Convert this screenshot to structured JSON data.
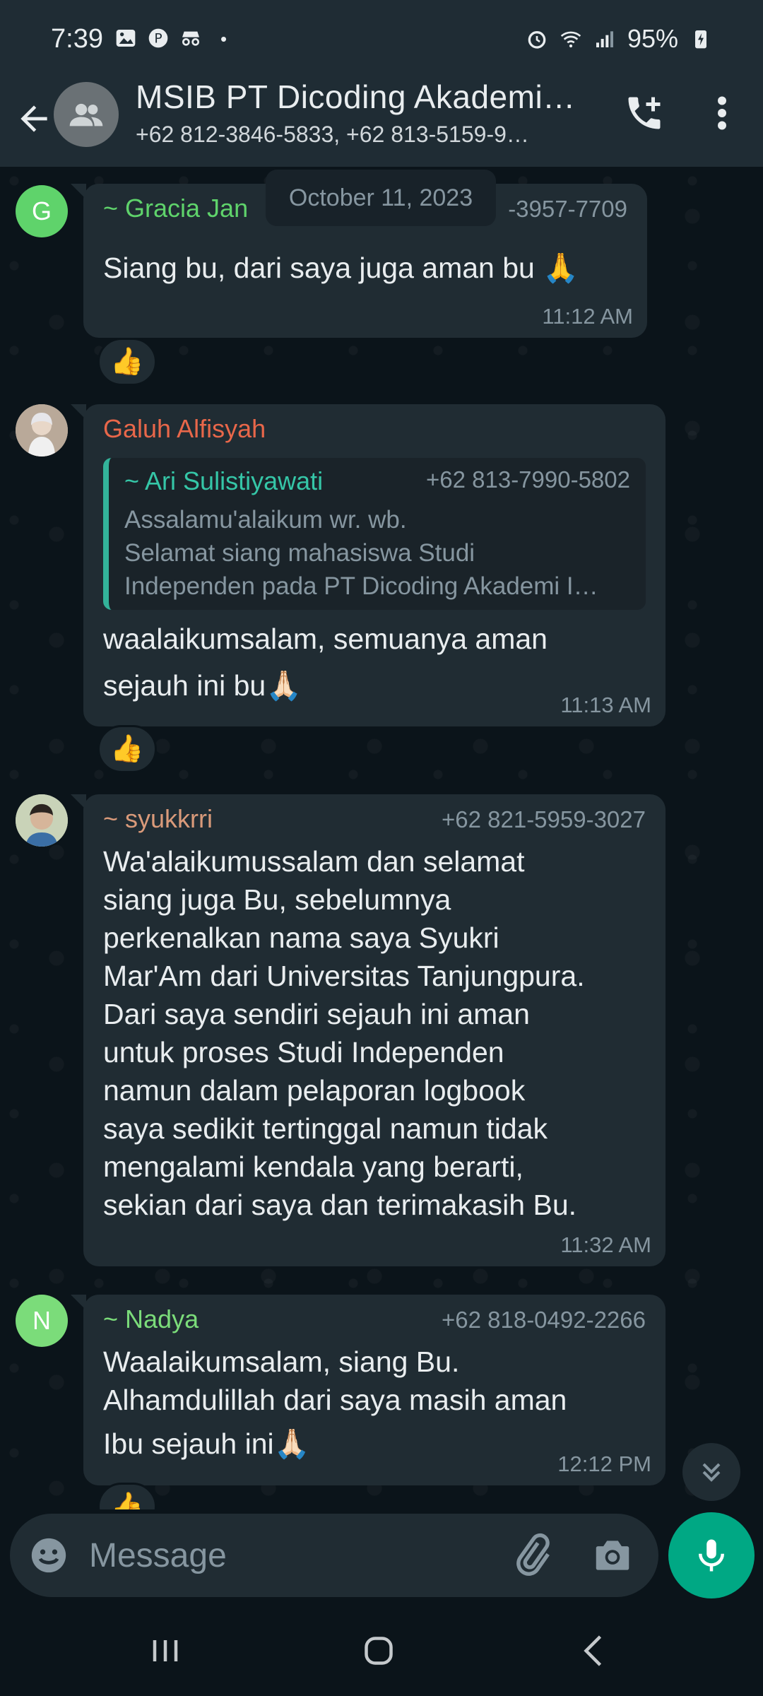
{
  "status_bar": {
    "time": "7:39",
    "dot": "•",
    "battery": "95%"
  },
  "header": {
    "title": "MSIB PT Dicoding Akademi…",
    "subtitle": "+62 812-3846-5833, +62 813-5159-9…"
  },
  "date_chip": "October 11, 2023",
  "messages": [
    {
      "avatar_letter": "G",
      "avatar_color": "#5fd36b",
      "sender": "~ Gracia Jan",
      "sender_color": "#5fd36b",
      "phone": "-3957-7709",
      "text": "Siang bu, dari saya juga aman bu 🙏",
      "time": "11:12 AM",
      "reaction": "👍"
    },
    {
      "sender": "Galuh Alfisyah",
      "sender_color": "#e8674a",
      "quote": {
        "name": "~ Ari Sulistiyawati",
        "phone": "+62 813-7990-5802",
        "lines": [
          "Assalamu'alaikum wr. wb.",
          "Selamat siang mahasiswa Studi",
          "Independen pada PT Dicoding Akademi I…"
        ]
      },
      "text_lines": [
        "waalaikumsalam, semuanya aman",
        "sejauh ini bu🙏🏻"
      ],
      "time": "11:13 AM",
      "reaction": "👍"
    },
    {
      "sender": "~ syukkrri",
      "sender_color": "#d99a7a",
      "phone": "+62 821-5959-3027",
      "text_lines": [
        "Wa'alaikumussalam dan selamat",
        "siang juga Bu, sebelumnya",
        "perkenalkan nama saya Syukri",
        "Mar'Am dari Universitas Tanjungpura.",
        "Dari saya sendiri sejauh ini aman",
        "untuk proses Studi Independen",
        "namun dalam pelaporan logbook",
        "saya sedikit tertinggal namun tidak",
        "mengalami kendala yang berarti,",
        "sekian dari saya dan terimakasih Bu."
      ],
      "time": "11:32 AM"
    },
    {
      "avatar_letter": "N",
      "avatar_color": "#7bdc7a",
      "sender": "~ Nadya",
      "sender_color": "#7bdc7a",
      "phone": "+62 818-0492-2266",
      "text_lines": [
        "Waalaikumsalam, siang Bu.",
        "Alhamdulillah dari saya masih aman",
        "Ibu sejauh ini🙏🏻"
      ],
      "time": "12:12 PM",
      "reaction": "👍"
    }
  ],
  "input": {
    "placeholder": "Message"
  },
  "icons": {
    "back": "arrow-left-icon",
    "group": "group-avatar-icon",
    "call": "add-call-icon",
    "more": "more-vert-icon",
    "emoji": "emoji-icon",
    "attach": "paperclip-icon",
    "camera": "camera-icon",
    "mic": "mic-icon",
    "scroll": "double-chevron-down-icon"
  },
  "colors": {
    "accent": "#00a884",
    "bubble": "#202c33",
    "background": "#0b141a",
    "header": "#1f2c34"
  }
}
